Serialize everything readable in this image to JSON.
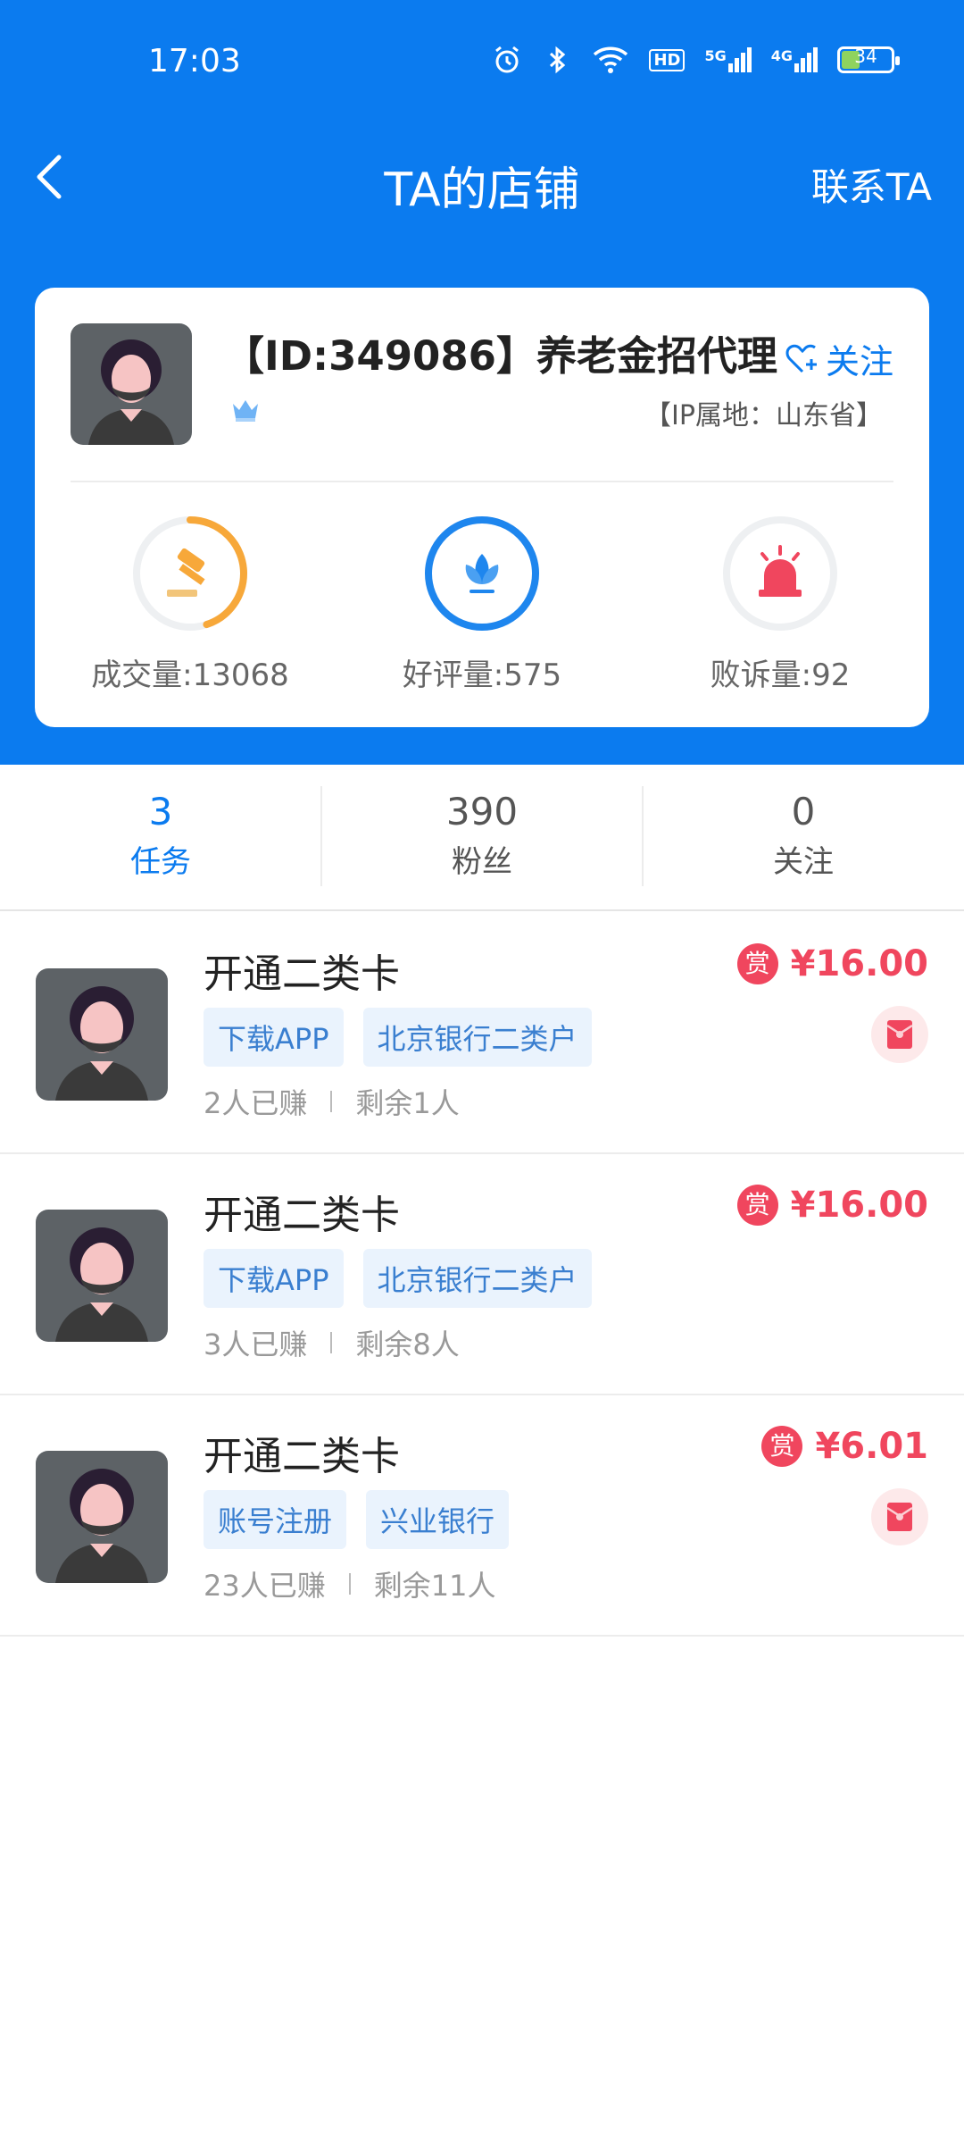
{
  "status_bar": {
    "time": "17:03",
    "icons": [
      "alarm-icon",
      "bluetooth-icon",
      "wifi-icon",
      "hd-icon",
      "5g-signal-icon",
      "4g-signal-icon",
      "battery-icon"
    ],
    "hd": "HD",
    "g5": "5G",
    "g4": "4G",
    "battery": "34"
  },
  "nav": {
    "title": "TA的店铺",
    "contact": "联系TA"
  },
  "shop": {
    "name": "【ID:349086】养老金招代理",
    "follow": "关注",
    "ip": "【IP属地：山东省】",
    "stats": [
      {
        "label": "成交量:13068",
        "icon": "gavel-icon",
        "color": "#f7a83a",
        "progress": 0.45
      },
      {
        "label": "好评量:575",
        "icon": "lotus-icon",
        "color": "#1e86ee",
        "progress": 1.0
      },
      {
        "label": "败诉量:92",
        "icon": "alarm-light-icon",
        "color": "#f0465e",
        "progress": 0
      }
    ]
  },
  "tabs": [
    {
      "num": "3",
      "label": "任务",
      "active": true
    },
    {
      "num": "390",
      "label": "粉丝",
      "active": false
    },
    {
      "num": "0",
      "label": "关注",
      "active": false
    }
  ],
  "tasks": [
    {
      "title": "开通二类卡",
      "tags": [
        "下载APP",
        "北京银行二类户"
      ],
      "earned": "2人已赚",
      "remaining": "剩余1人",
      "badge": "赏",
      "price": "¥16.00",
      "redpack": true
    },
    {
      "title": "开通二类卡",
      "tags": [
        "下载APP",
        "北京银行二类户"
      ],
      "earned": "3人已赚",
      "remaining": "剩余8人",
      "badge": "赏",
      "price": "¥16.00",
      "redpack": false
    },
    {
      "title": "开通二类卡",
      "tags": [
        "账号注册",
        "兴业银行"
      ],
      "earned": "23人已赚",
      "remaining": "剩余11人",
      "badge": "赏",
      "price": "¥6.01",
      "redpack": true
    }
  ],
  "colors": {
    "brand": "#0b7bef",
    "price": "#f0465e",
    "tag_bg": "#eaf3fd",
    "tag_text": "#3a7fd0"
  }
}
